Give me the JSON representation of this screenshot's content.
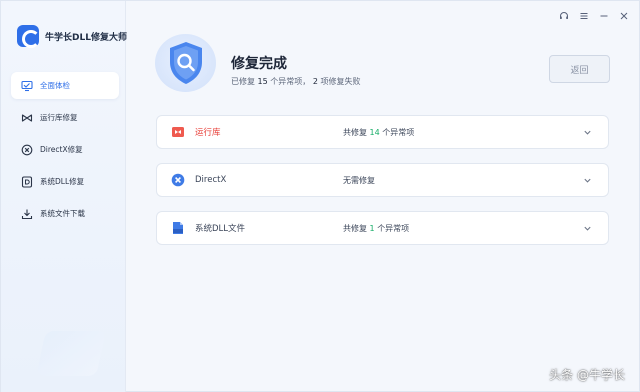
{
  "app": {
    "name": "牛学长DLL修复大师"
  },
  "sidebar": {
    "items": [
      {
        "label": "全面体检",
        "icon": "monitor-check-icon",
        "active": true
      },
      {
        "label": "运行库修复",
        "icon": "bowtie-icon",
        "active": false
      },
      {
        "label": "DirectX修复",
        "icon": "x-circle-icon",
        "active": false
      },
      {
        "label": "系统DLL修复",
        "icon": "dll-file-icon",
        "active": false
      },
      {
        "label": "系统文件下载",
        "icon": "download-icon",
        "active": false
      }
    ]
  },
  "header": {
    "title": "修复完成",
    "summary": {
      "prefix": "已修复",
      "fixed": "15",
      "mid": "个异常项，",
      "failed": "2",
      "suffix": "项修复失败"
    },
    "back_label": "返回"
  },
  "results": [
    {
      "name": "运行库",
      "icon": "runtime-icon",
      "status_prefix": "共修复",
      "count": "14",
      "status_suffix": "个异常项",
      "highlight": true
    },
    {
      "name": "DirectX",
      "icon": "directx-icon",
      "status_prefix": "无需修复",
      "count": "",
      "status_suffix": "",
      "highlight": false
    },
    {
      "name": "系统DLL文件",
      "icon": "dll-icon",
      "status_prefix": "共修复",
      "count": "1",
      "status_suffix": "个异常项",
      "highlight": false
    }
  ],
  "watermark": "头条 @牛学长",
  "colors": {
    "accent": "#2f6fe8",
    "success": "#1aae6a",
    "error": "#e8403a"
  }
}
